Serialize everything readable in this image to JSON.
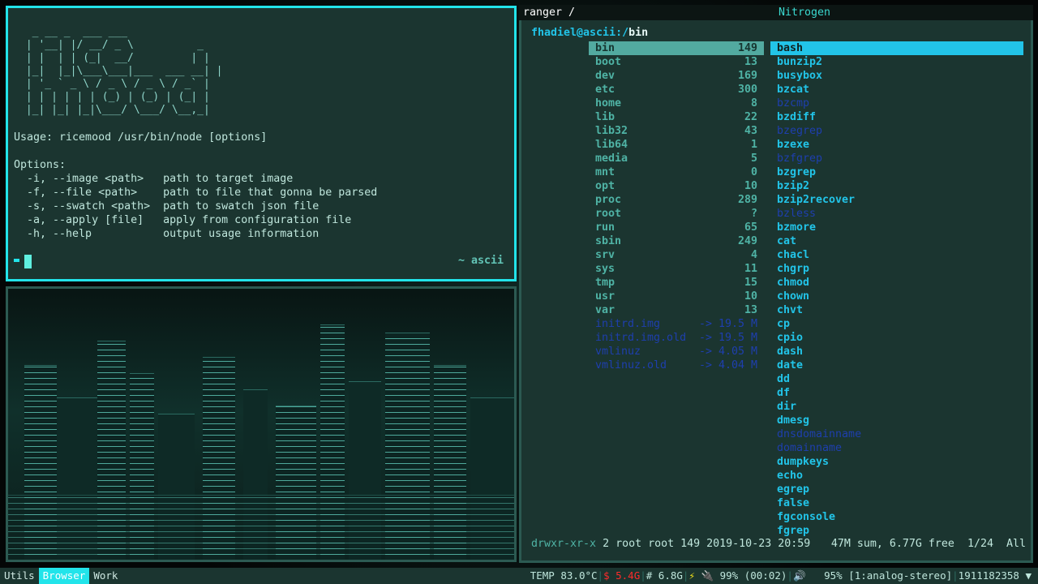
{
  "terminal": {
    "ascii_logo": "  _ __ _  ___ ___\n | '__| |/ __/ _ \\          _\n | |  | | (_|  __/         | |\n |_|  |_|\\___\\___|___  ___ __| |\n | '_ ` _ \\ / _ \\ / _ \\ / _` |\n | | | | | | (_) | (_) | (_| |\n |_| |_| |_|\\___/ \\___/ \\__,_|",
    "usage": "Usage: ricemood /usr/bin/node [options]",
    "options_title": "Options:",
    "options": [
      "  -i, --image <path>   path to target image",
      "  -f, --file <path>    path to file that gonna be parsed",
      "  -s, --swatch <path>  path to swatch json file",
      "  -a, --apply [file]   apply from configuration file",
      "  -h, --help           output usage information"
    ],
    "right_prompt": "~ ascii"
  },
  "ranger": {
    "title": "ranger /",
    "window_name": "Nitrogen",
    "path_user": "fhadiel@ascii:/",
    "path_dir": "bin",
    "left_col": [
      {
        "name": "bin",
        "size": "149",
        "sel": true
      },
      {
        "name": "boot",
        "size": "13"
      },
      {
        "name": "dev",
        "size": "169"
      },
      {
        "name": "etc",
        "size": "300"
      },
      {
        "name": "home",
        "size": "8"
      },
      {
        "name": "lib",
        "size": "22"
      },
      {
        "name": "lib32",
        "size": "43"
      },
      {
        "name": "lib64",
        "size": "1"
      },
      {
        "name": "media",
        "size": "5"
      },
      {
        "name": "mnt",
        "size": "0"
      },
      {
        "name": "opt",
        "size": "10"
      },
      {
        "name": "proc",
        "size": "289"
      },
      {
        "name": "root",
        "size": "?"
      },
      {
        "name": "run",
        "size": "65"
      },
      {
        "name": "sbin",
        "size": "249"
      },
      {
        "name": "srv",
        "size": "4"
      },
      {
        "name": "sys",
        "size": "11"
      },
      {
        "name": "tmp",
        "size": "15"
      },
      {
        "name": "usr",
        "size": "10"
      },
      {
        "name": "var",
        "size": "13"
      },
      {
        "name": "initrd.img",
        "size": "-> 19.5 M",
        "link": true
      },
      {
        "name": "initrd.img.old",
        "size": "-> 19.5 M",
        "link": true
      },
      {
        "name": "vmlinuz",
        "size": "-> 4.05 M",
        "link": true
      },
      {
        "name": "vmlinuz.old",
        "size": "-> 4.04 M",
        "link": true
      }
    ],
    "right_col": [
      {
        "name": "bash",
        "sel": true
      },
      {
        "name": "bunzip2"
      },
      {
        "name": "busybox"
      },
      {
        "name": "bzcat"
      },
      {
        "name": "bzcmp",
        "link": true
      },
      {
        "name": "bzdiff"
      },
      {
        "name": "bzegrep",
        "link": true
      },
      {
        "name": "bzexe"
      },
      {
        "name": "bzfgrep",
        "link": true
      },
      {
        "name": "bzgrep"
      },
      {
        "name": "bzip2"
      },
      {
        "name": "bzip2recover"
      },
      {
        "name": "bzless",
        "link": true
      },
      {
        "name": "bzmore"
      },
      {
        "name": "cat"
      },
      {
        "name": "chacl"
      },
      {
        "name": "chgrp"
      },
      {
        "name": "chmod"
      },
      {
        "name": "chown"
      },
      {
        "name": "chvt"
      },
      {
        "name": "cp"
      },
      {
        "name": "cpio"
      },
      {
        "name": "dash"
      },
      {
        "name": "date"
      },
      {
        "name": "dd"
      },
      {
        "name": "df"
      },
      {
        "name": "dir"
      },
      {
        "name": "dmesg"
      },
      {
        "name": "dnsdomainname",
        "link": true
      },
      {
        "name": "domainname",
        "link": true
      },
      {
        "name": "dumpkeys"
      },
      {
        "name": "echo"
      },
      {
        "name": "egrep"
      },
      {
        "name": "false"
      },
      {
        "name": "fgconsole"
      },
      {
        "name": "fgrep"
      }
    ],
    "status_perm": "drwxr-xr-x",
    "status_info": " 2 root root 149 2019-10-23 20:59",
    "status_right": "47M sum, 6.77G free  1/24  All"
  },
  "taskbar": {
    "workspaces": [
      {
        "label": "Utils"
      },
      {
        "label": "Browser",
        "active": true
      },
      {
        "label": "Work"
      }
    ],
    "temp": "TEMP 83.0°C",
    "swap": "$ 5.4G",
    "mem": "# 6.8G",
    "battery": "99% (00:02)",
    "volume": "95% [1:analog-stereo]",
    "clock": "1911182358"
  },
  "colors": {
    "accent": "#22e4ea",
    "bg": "#1b3530",
    "dir": "#4fb3a5",
    "exec": "#22c4e8",
    "link": "#1e3fae",
    "warn": "#ff2a2a"
  }
}
